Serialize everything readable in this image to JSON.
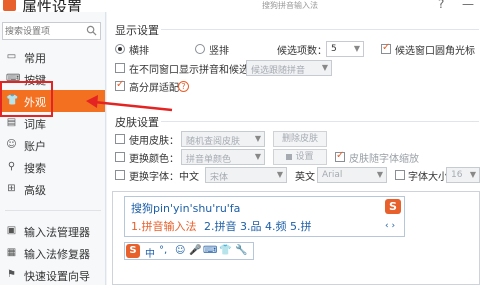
{
  "window": {
    "title": "属性设置",
    "subtitle": "搜狗拼音输入法",
    "help_label": "?",
    "close_label": "—"
  },
  "sidebar": {
    "search_placeholder": "搜索设置项",
    "items": [
      {
        "label": "常用",
        "icon": "monitor-icon"
      },
      {
        "label": "按键",
        "icon": "keyboard-icon"
      },
      {
        "label": "外观",
        "icon": "shirt-icon"
      },
      {
        "label": "词库",
        "icon": "book-icon"
      },
      {
        "label": "账户",
        "icon": "user-icon"
      },
      {
        "label": "搜索",
        "icon": "search-icon"
      },
      {
        "label": "高级",
        "icon": "advanced-icon"
      },
      {
        "label": "输入法管理器",
        "icon": "manager-icon"
      },
      {
        "label": "输入法修复器",
        "icon": "repair-icon"
      },
      {
        "label": "快速设置向导",
        "icon": "wizard-icon"
      }
    ],
    "active_index": 2,
    "active_color": "#f37021"
  },
  "display": {
    "section_title": "显示设置",
    "horizontal_label": "横排",
    "vertical_label": "竖排",
    "cand_count_label": "候选项数：",
    "cand_count_value": "5",
    "round_corner_label": "候选窗口圆角光标",
    "pinyin_window_label": "在不同窗口显示拼音和候选词",
    "pinyin_window_select": "候选跟随拼音",
    "hidpi_label": "高分屏适配",
    "help_glyph": "?"
  },
  "skin": {
    "section_title": "皮肤设置",
    "use_skin_label": "使用皮肤：",
    "use_skin_value": "随机查阅皮肤",
    "delete_skin_label": "删除皮肤",
    "change_color_label": "更换颜色：",
    "change_color_value": "拼音单颜色",
    "settings_button": "设置",
    "follow_font_label": "皮肤随字体缩放",
    "change_font_label": "更换字体：中文",
    "font_zh_value": "宋体",
    "english_label": "英文",
    "font_en_value": "Arial",
    "font_size_label": "字体大小",
    "font_size_value": "16"
  },
  "preview": {
    "pinyin": "搜狗pin'yin'shu'ru'fa",
    "candidate_first": "1.拼音输入法",
    "candidates_rest": "2.拼音  3.品  4.频  5.拼",
    "nav_arrows": "‹ ›",
    "logo_letter": "S",
    "toolbar_text": "中",
    "toolbar_icons": [
      "°,",
      "☺",
      "🎤",
      "⌨",
      "👕",
      "🔧"
    ]
  },
  "colors": {
    "accent": "#e8602c",
    "highlight_border": "#e42323",
    "candidate_blue": "#1d5fa8"
  }
}
